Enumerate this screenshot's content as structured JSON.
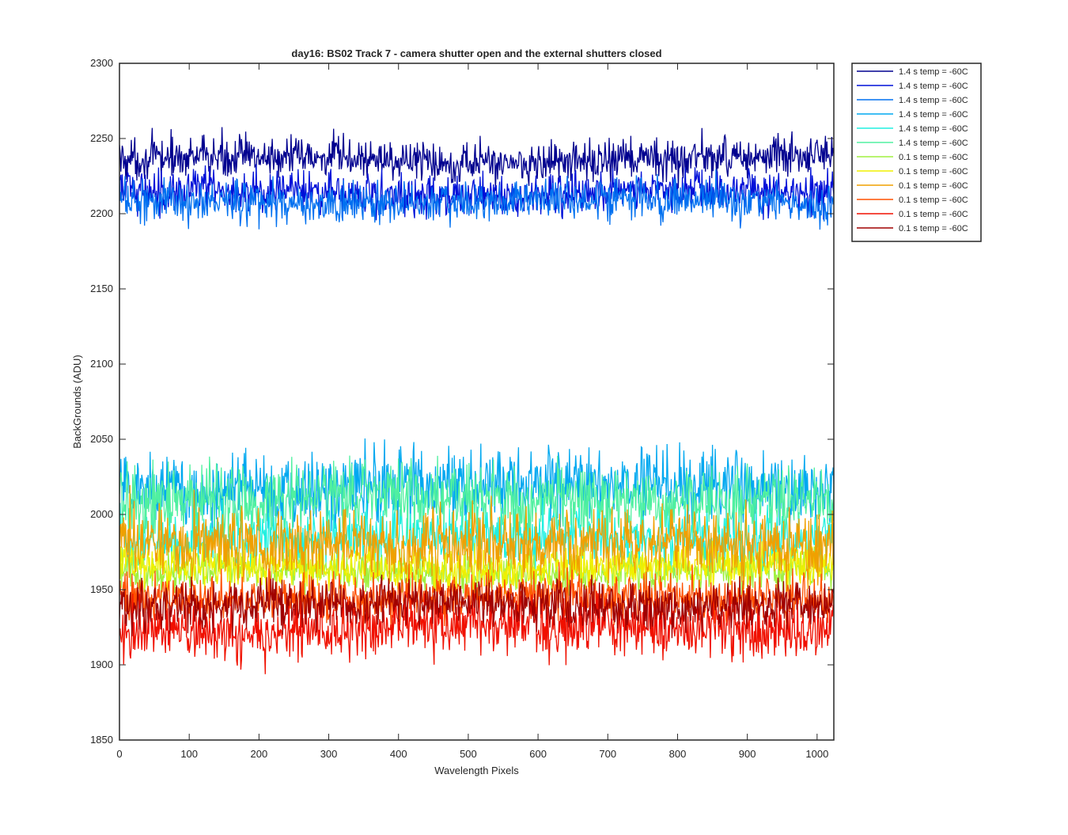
{
  "chart_data": {
    "type": "line",
    "title": "day16: BS02  Track 7 - camera shutter open and the external shutters closed",
    "xlabel": "Wavelength Pixels",
    "ylabel": "BackGrounds (ADU)",
    "xlim": [
      0,
      1024
    ],
    "ylim": [
      1850,
      2300
    ],
    "xticks": [
      0,
      100,
      200,
      300,
      400,
      500,
      600,
      700,
      800,
      900,
      1000
    ],
    "yticks": [
      1850,
      1900,
      1950,
      2000,
      2050,
      2100,
      2150,
      2200,
      2250,
      2300
    ],
    "grid": false,
    "legend_position": "outside-top-right",
    "series": [
      {
        "name": "1.4 s temp = -60C",
        "color": "#00008F",
        "mean": 2236,
        "noise": 7
      },
      {
        "name": "1.4 s temp = -60C",
        "color": "#0010D8",
        "mean": 2214,
        "noise": 7
      },
      {
        "name": "1.4 s temp = -60C",
        "color": "#0070F0",
        "mean": 2208,
        "noise": 7
      },
      {
        "name": "1.4 s temp = -60C",
        "color": "#00A8F0",
        "mean": 2018,
        "noise": 12
      },
      {
        "name": "1.4 s temp = -60C",
        "color": "#20F0E0",
        "mean": 1985,
        "noise": 10
      },
      {
        "name": "1.4 s temp = -60C",
        "color": "#50F0A0",
        "mean": 2010,
        "noise": 12
      },
      {
        "name": "0.1 s temp = -60C",
        "color": "#A0F040",
        "mean": 1962,
        "noise": 7
      },
      {
        "name": "0.1 s temp = -60C",
        "color": "#F0F000",
        "mean": 1965,
        "noise": 7
      },
      {
        "name": "0.1 s temp = -60C",
        "color": "#F0A000",
        "mean": 1980,
        "noise": 12
      },
      {
        "name": "0.1 s temp = -60C",
        "color": "#FF5000",
        "mean": 1945,
        "noise": 8
      },
      {
        "name": "0.1 s temp = -60C",
        "color": "#F01000",
        "mean": 1925,
        "noise": 10
      },
      {
        "name": "0.1 s temp = -60C",
        "color": "#A00000",
        "mean": 1940,
        "noise": 8
      }
    ]
  }
}
